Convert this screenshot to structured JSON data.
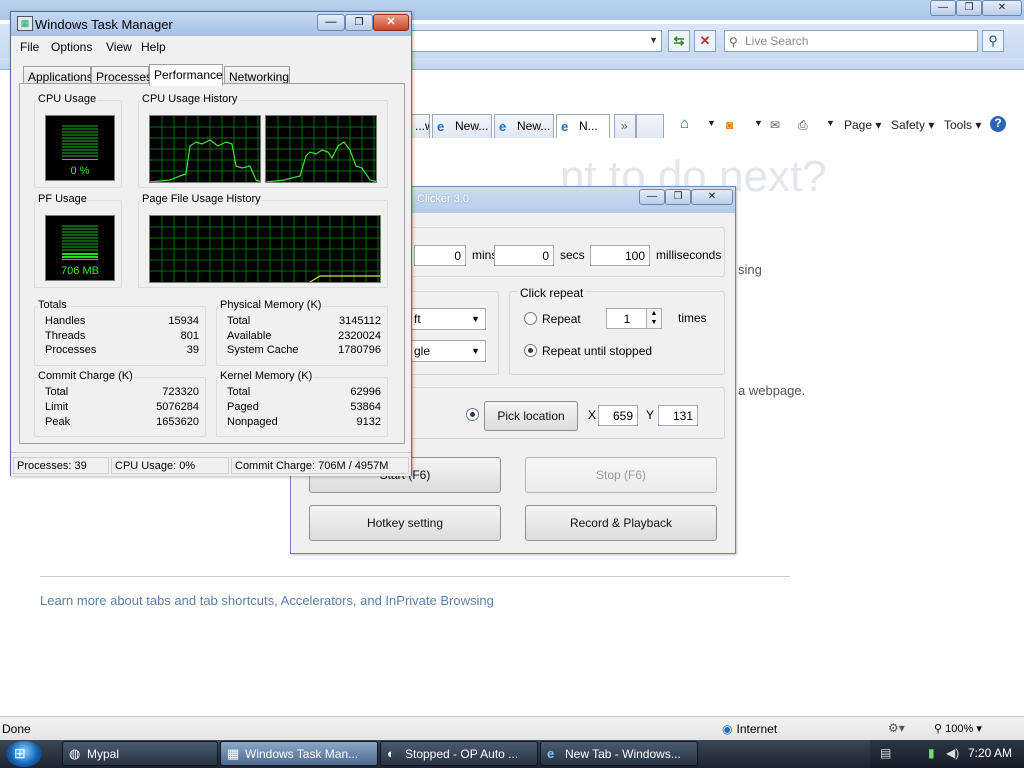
{
  "ie": {
    "search_placeholder": "Live Search",
    "tabs": [
      "...w...",
      "New...",
      "New...",
      "N..."
    ],
    "tab_more": "»",
    "commands": {
      "page": "Page ▾",
      "safety": "Safety ▾",
      "tools": "Tools ▾"
    },
    "ghost_heading": "nt to do next?",
    "body_line1": "sing",
    "body_line2": "a webpage.",
    "learn_more": "Learn more about tabs and tab shortcuts, Accelerators, and InPrivate Browsing",
    "status_done": "Done",
    "status_zone": "Internet",
    "zoom": "100%"
  },
  "clicker": {
    "title": "Clicker 3.0",
    "mins_value": "0",
    "mins_label": "mins",
    "secs_value": "0",
    "secs_label": "secs",
    "ms_value": "100",
    "ms_label": "milliseconds",
    "button_dd": "ft",
    "type_dd": "gle",
    "click_repeat_title": "Click repeat",
    "repeat_label": "Repeat",
    "repeat_times": "1",
    "times_label": "times",
    "repeat_until_label": "Repeat until stopped",
    "pick_location": "Pick location",
    "x_label": "X",
    "x_value": "659",
    "y_label": "Y",
    "y_value": "131",
    "start": "Start (F6)",
    "stop": "Stop (F6)",
    "hotkey": "Hotkey setting",
    "record": "Record & Playback"
  },
  "taskmgr": {
    "title": "Windows Task Manager",
    "menu": [
      "File",
      "Options",
      "View",
      "Help"
    ],
    "tabs": [
      "Applications",
      "Processes",
      "Performance",
      "Networking"
    ],
    "active_tab": "Performance",
    "cpu_usage_title": "CPU Usage",
    "cpu_usage_value": "0 %",
    "cpu_usage_fraction": 0.02,
    "cpu_history_title": "CPU Usage History",
    "pf_usage_title": "PF Usage",
    "pf_usage_value": "706 MB",
    "pf_usage_fraction": 0.22,
    "pf_history_title": "Page File Usage History",
    "totals": {
      "title": "Totals",
      "rows": [
        {
          "label": "Handles",
          "value": "15934"
        },
        {
          "label": "Threads",
          "value": "801"
        },
        {
          "label": "Processes",
          "value": "39"
        }
      ]
    },
    "physical": {
      "title": "Physical Memory (K)",
      "rows": [
        {
          "label": "Total",
          "value": "3145112"
        },
        {
          "label": "Available",
          "value": "2320024"
        },
        {
          "label": "System Cache",
          "value": "1780796"
        }
      ]
    },
    "commit": {
      "title": "Commit Charge (K)",
      "rows": [
        {
          "label": "Total",
          "value": "723320"
        },
        {
          "label": "Limit",
          "value": "5076284"
        },
        {
          "label": "Peak",
          "value": "1653620"
        }
      ]
    },
    "kernel": {
      "title": "Kernel Memory (K)",
      "rows": [
        {
          "label": "Total",
          "value": "62996"
        },
        {
          "label": "Paged",
          "value": "53864"
        },
        {
          "label": "Nonpaged",
          "value": "9132"
        }
      ]
    },
    "status": {
      "processes": "Processes: 39",
      "cpu": "CPU Usage: 0%",
      "commit": "Commit Charge: 706M / 4957M"
    }
  },
  "taskbar": {
    "buttons": [
      {
        "label": "Mypal",
        "icon": "mypal-icon"
      },
      {
        "label": "Windows Task Man...",
        "icon": "task-manager-icon"
      },
      {
        "label": "Stopped - OP Auto ...",
        "icon": "auto-clicker-icon"
      },
      {
        "label": "New Tab - Windows...",
        "icon": "ie-icon"
      }
    ],
    "clock": "7:20 AM"
  }
}
